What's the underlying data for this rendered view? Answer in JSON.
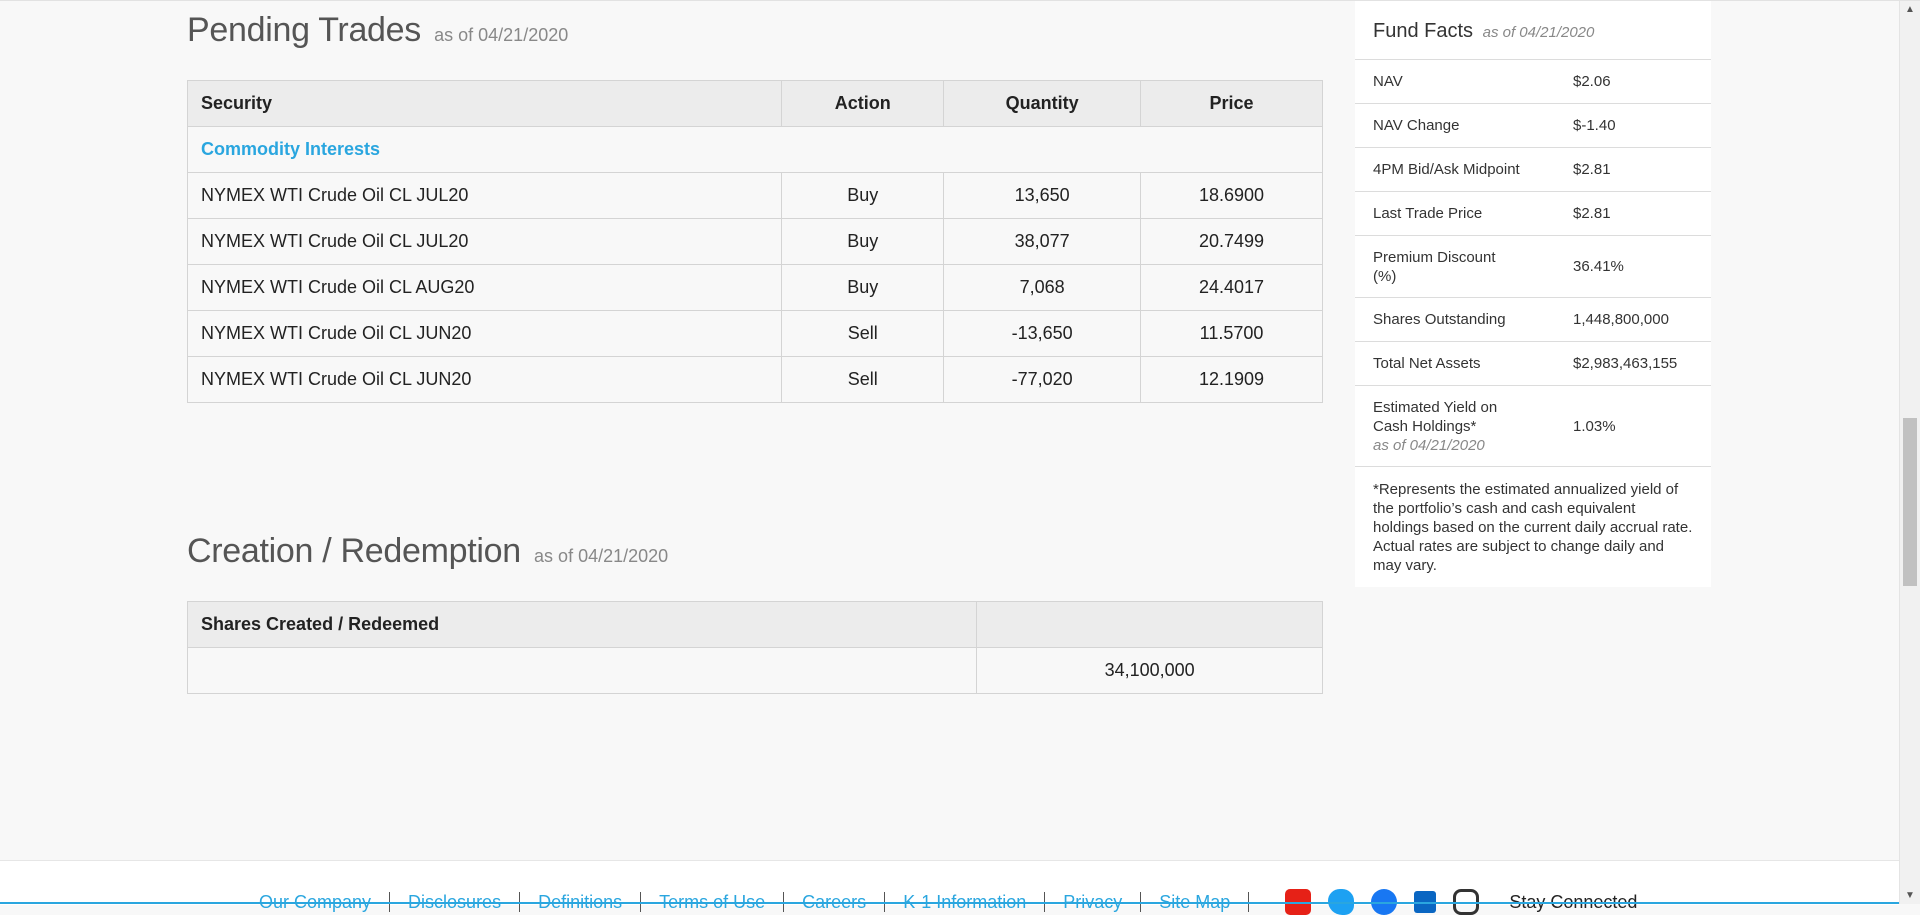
{
  "pending_trades": {
    "title": "Pending Trades",
    "as_of": "as of 04/21/2020",
    "headers": [
      "Security",
      "Action",
      "Quantity",
      "Price"
    ],
    "category": "Commodity Interests",
    "rows": [
      {
        "security": "NYMEX WTI Crude Oil CL JUL20",
        "action": "Buy",
        "quantity": "13,650",
        "price": "18.6900"
      },
      {
        "security": "NYMEX WTI Crude Oil CL JUL20",
        "action": "Buy",
        "quantity": "38,077",
        "price": "20.7499"
      },
      {
        "security": "NYMEX WTI Crude Oil CL AUG20",
        "action": "Buy",
        "quantity": "7,068",
        "price": "24.4017"
      },
      {
        "security": "NYMEX WTI Crude Oil CL JUN20",
        "action": "Sell",
        "quantity": "-13,650",
        "price": "11.5700"
      },
      {
        "security": "NYMEX WTI Crude Oil CL JUN20",
        "action": "Sell",
        "quantity": "-77,020",
        "price": "12.1909"
      }
    ]
  },
  "creation_redemption": {
    "title": "Creation / Redemption",
    "as_of": "as of 04/21/2020",
    "header": "Shares Created / Redeemed",
    "value": "34,100,000"
  },
  "fund_facts": {
    "title": "Fund Facts",
    "as_of": "as of 04/21/2020",
    "rows": [
      {
        "label": "NAV",
        "value": "$2.06"
      },
      {
        "label": "NAV Change",
        "value": "$-1.40"
      },
      {
        "label": "4PM Bid/Ask Midpoint",
        "value": "$2.81"
      },
      {
        "label": "Last Trade Price",
        "value": "$2.81"
      },
      {
        "label": "Premium Discount (%)",
        "value": "36.41%"
      },
      {
        "label": "Shares Outstanding",
        "value": "1,448,800,000"
      },
      {
        "label": "Total Net Assets",
        "value": "$2,983,463,155"
      },
      {
        "label": "Estimated Yield on Cash Holdings*",
        "sub": "as of 04/21/2020",
        "value": "1.03%"
      }
    ],
    "note": "*Represents the estimated annualized yield of the portfolio’s cash and cash equivalent holdings based on the current daily accrual rate. Actual rates are subject to change daily and may vary."
  },
  "footer": {
    "links": [
      "Our Company",
      "Disclosures",
      "Definitions",
      "Terms of Use",
      "Careers",
      "K-1 Information",
      "Privacy",
      "Site Map"
    ],
    "social": [
      {
        "icon": "youtube-icon",
        "color": "#e62117"
      },
      {
        "icon": "twitter-icon",
        "color": "#1da1f2"
      },
      {
        "icon": "facebook-icon",
        "color": "#1877f2"
      },
      {
        "icon": "linkedin-icon",
        "color": "#0a66c2"
      },
      {
        "icon": "instagram-icon",
        "color": "#333333"
      }
    ],
    "stay_connected": "Stay Connected"
  },
  "colors": {
    "accent": "#2aa6df",
    "background": "#f8f8f8"
  }
}
